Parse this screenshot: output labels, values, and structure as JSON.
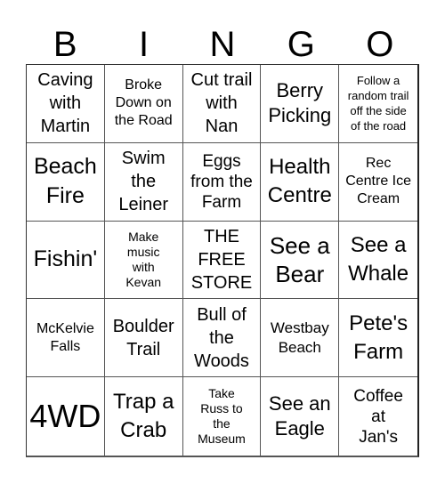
{
  "header": {
    "letters": [
      "B",
      "I",
      "N",
      "G",
      "O"
    ]
  },
  "cells": [
    {
      "text": "Caving with Martin",
      "lines": [
        "Caving",
        "with",
        "Martin"
      ]
    },
    {
      "text": "Broke Down on the Road",
      "lines": [
        "Broke",
        "Down on",
        "the Road"
      ]
    },
    {
      "text": "Cut trail with Nan",
      "lines": [
        "Cut trail",
        "with",
        "Nan"
      ]
    },
    {
      "text": "Berry Picking",
      "lines": [
        "Berry",
        "Picking"
      ]
    },
    {
      "text": "Follow a random trail off the side of the road",
      "lines": [
        "Follow a",
        "random trail",
        "off the side",
        "of the road"
      ]
    },
    {
      "text": "Beach Fire",
      "lines": [
        "Beach",
        "Fire"
      ]
    },
    {
      "text": "Swim the Leiner",
      "lines": [
        "Swim",
        "the",
        "Leiner"
      ]
    },
    {
      "text": "Eggs from the Farm",
      "lines": [
        "Eggs",
        "from the",
        "Farm"
      ]
    },
    {
      "text": "Health Centre",
      "lines": [
        "Health",
        "Centre"
      ]
    },
    {
      "text": "Rec Centre Ice Cream",
      "lines": [
        "Rec",
        "Centre Ice",
        "Cream"
      ]
    },
    {
      "text": "Fishin'",
      "lines": [
        "Fishin'"
      ]
    },
    {
      "text": "Make music with Kevan",
      "lines": [
        "Make",
        "music",
        "with",
        "Kevan"
      ]
    },
    {
      "text": "THE FREE STORE",
      "lines": [
        "THE",
        "FREE",
        "STORE"
      ]
    },
    {
      "text": "See a Bear",
      "lines": [
        "See a",
        "Bear"
      ]
    },
    {
      "text": "See a Whale",
      "lines": [
        "See a",
        "Whale"
      ]
    },
    {
      "text": "McKelvie Falls",
      "lines": [
        "McKelvie",
        "Falls"
      ]
    },
    {
      "text": "Boulder Trail",
      "lines": [
        "Boulder",
        "Trail"
      ]
    },
    {
      "text": "Bull of the Woods",
      "lines": [
        "Bull of",
        "the",
        "Woods"
      ]
    },
    {
      "text": "Westbay Beach",
      "lines": [
        "Westbay",
        "Beach"
      ]
    },
    {
      "text": "Pete's Farm",
      "lines": [
        "Pete's",
        "Farm"
      ]
    },
    {
      "text": "4WD",
      "lines": [
        "4WD"
      ]
    },
    {
      "text": "Trap a Crab",
      "lines": [
        "Trap a",
        "Crab"
      ]
    },
    {
      "text": "Take Russ to the Museum",
      "lines": [
        "Take",
        "Russ to",
        "the",
        "Museum"
      ]
    },
    {
      "text": "See an Eagle",
      "lines": [
        "See an",
        "Eagle"
      ]
    },
    {
      "text": "Coffee at Jan's",
      "lines": [
        "Coffee",
        "at",
        "Jan's"
      ]
    }
  ]
}
